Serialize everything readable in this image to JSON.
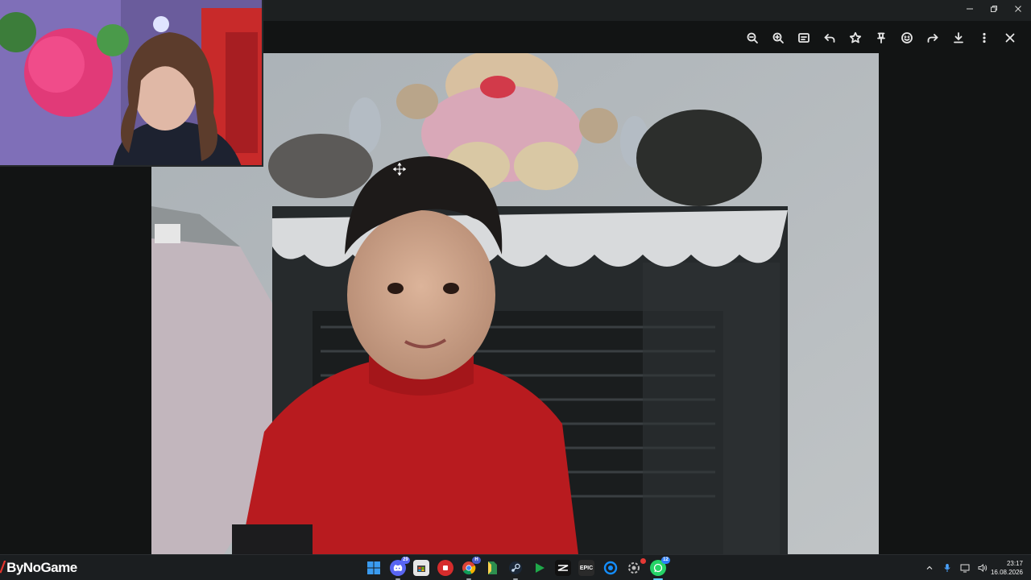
{
  "window": {
    "controls": [
      {
        "name": "minimize-button",
        "glyph": "—"
      },
      {
        "name": "restore-button",
        "glyph": "❐"
      },
      {
        "name": "close-window-button",
        "glyph": "✕"
      }
    ]
  },
  "toolbar": {
    "buttons": [
      {
        "name": "zoom-out-button",
        "icon": "zoom-out-icon"
      },
      {
        "name": "zoom-in-button",
        "icon": "zoom-in-icon"
      },
      {
        "name": "caption-button",
        "icon": "caption-icon"
      },
      {
        "name": "reply-button",
        "icon": "reply-icon"
      },
      {
        "name": "star-button",
        "icon": "star-icon"
      },
      {
        "name": "pin-button",
        "icon": "pin-icon"
      },
      {
        "name": "react-button",
        "icon": "emoji-icon"
      },
      {
        "name": "forward-button",
        "icon": "forward-icon"
      },
      {
        "name": "download-button",
        "icon": "download-icon"
      },
      {
        "name": "more-options-button",
        "icon": "kebab-icon"
      },
      {
        "name": "close-viewer-button",
        "icon": "close-icon"
      }
    ]
  },
  "taskbar": {
    "brand": "ByNoGame",
    "brand_mark": "/",
    "apps": [
      {
        "name": "windows-start",
        "icon": "windows-icon",
        "color": "#3a9bf0"
      },
      {
        "name": "discord",
        "icon": "discord-icon",
        "color": "#5865f2",
        "badge": "29"
      },
      {
        "name": "microsoft-store",
        "icon": "store-icon",
        "color": "#e6e6e6"
      },
      {
        "name": "streaming-app",
        "icon": "red-app-icon",
        "color": "#d62c2c"
      },
      {
        "name": "chrome",
        "icon": "chrome-icon",
        "color": "#4285f4",
        "badge": "H"
      },
      {
        "name": "file-app",
        "icon": "file-icon",
        "color": "#2d8f4e"
      },
      {
        "name": "steam",
        "icon": "steam-icon",
        "color": "#1b2838"
      },
      {
        "name": "media-app",
        "icon": "play-icon",
        "color": "#1fa84a"
      },
      {
        "name": "capcut",
        "icon": "capcut-icon",
        "color": "#111111"
      },
      {
        "name": "epic-games",
        "icon": "epic-icon",
        "color": "#2a2a2a"
      },
      {
        "name": "battlenet",
        "icon": "battlenet-icon",
        "color": "#148eff"
      },
      {
        "name": "settings-app",
        "icon": "gear-icon",
        "color": "#444444"
      },
      {
        "name": "whatsapp",
        "icon": "whatsapp-icon",
        "color": "#25d366",
        "badge": "12"
      }
    ],
    "tray": {
      "icons": [
        "chevron-up-icon",
        "microphone-icon",
        "network-icon",
        "speaker-icon"
      ],
      "time": "23:17",
      "date": "16.08.2026"
    }
  }
}
